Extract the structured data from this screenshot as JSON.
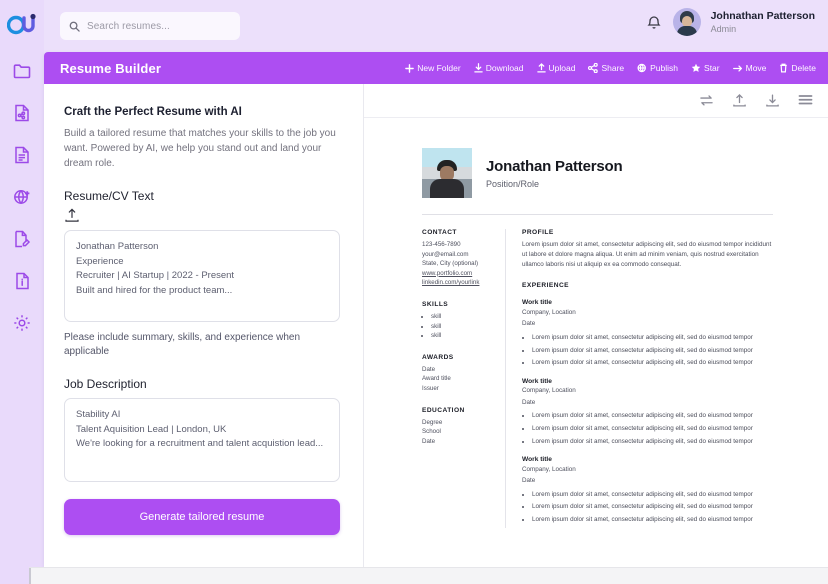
{
  "app": {
    "logo_name": "cu-logo",
    "search": {
      "placeholder": "Search resumes...",
      "value": ""
    },
    "user": {
      "name": "Johnathan Patterson",
      "role": "Admin"
    }
  },
  "sidebar": {
    "items": [
      {
        "icon": "folder-icon",
        "label": "Folders"
      },
      {
        "icon": "shared-file-icon",
        "label": "Shared"
      },
      {
        "icon": "document-icon",
        "label": "Documents"
      },
      {
        "icon": "network-add-icon",
        "label": "Network"
      },
      {
        "icon": "file-edit-icon",
        "label": "Edit"
      },
      {
        "icon": "file-info-icon",
        "label": "Info"
      },
      {
        "icon": "gear-icon",
        "label": "Settings"
      }
    ]
  },
  "window": {
    "title": "Resume Builder",
    "actions": [
      {
        "icon": "plus-icon",
        "label": "New Folder"
      },
      {
        "icon": "download-icon",
        "label": "Download"
      },
      {
        "icon": "upload-icon",
        "label": "Upload"
      },
      {
        "icon": "share-icon",
        "label": "Share"
      },
      {
        "icon": "publish-icon",
        "label": "Publish"
      },
      {
        "icon": "star-icon",
        "label": "Star"
      },
      {
        "icon": "move-icon",
        "label": "Move"
      },
      {
        "icon": "trash-icon",
        "label": "Delete"
      }
    ]
  },
  "left_pane": {
    "title": "Craft the Perfect Resume with AI",
    "subtitle": "Build a tailored resume that matches your skills to the job you want. Powered by AI, we help you stand out and land your dream role.",
    "resume_label": "Resume/CV Text",
    "resume_value": "Jonathan Patterson\nExperience\nRecruiter | AI Startup | 2022 - Present\nBuilt and hired for the product team...",
    "hint": "Please include summary, skills, and experience when applicable",
    "jd_label": "Job Description",
    "jd_value": "Stability AI\nTalent Aquisition Lead | London, UK\nWe're looking for a recruitment and talent acquistion lead...",
    "generate_button": "Generate tailored resume"
  },
  "preview": {
    "toolbar_icons": [
      "swap-icon",
      "upload-icon",
      "download-icon",
      "menu-icon"
    ],
    "name": "Jonathan Patterson",
    "role": "Position/Role",
    "contact": {
      "heading": "CONTACT",
      "phone": "123-456-7890",
      "email": "your@email.com",
      "location": "State, City (optional)",
      "portfolio": "www.portfolio.com",
      "linkedin": "linkedin.com/yourlink"
    },
    "skills": {
      "heading": "SKILLS",
      "items": [
        "skill",
        "skill",
        "skill"
      ]
    },
    "awards": {
      "heading": "AWARDS",
      "date": "Date",
      "title": "Award title",
      "issuer": "Issuer"
    },
    "education": {
      "heading": "EDUCATION",
      "degree": "Degree",
      "school": "School",
      "date": "Date"
    },
    "profile": {
      "heading": "PROFILE",
      "body": "Lorem ipsum dolor sit amet, consectetur adipiscing elit, sed do eiusmod tempor incididunt ut labore et dolore magna aliqua. Ut enim ad minim veniam, quis nostrud exercitation ullamco laboris nisi ut aliquip ex ea commodo consequat."
    },
    "experience": {
      "heading": "EXPERIENCE",
      "jobs": [
        {
          "title": "Work title",
          "company": "Company, Location",
          "date": "Date",
          "bullets": [
            "Lorem ipsum dolor sit amet, consectetur adipiscing elit, sed do eiusmod tempor",
            "Lorem ipsum dolor sit amet, consectetur adipiscing elit, sed do eiusmod tempor",
            "Lorem ipsum dolor sit amet, consectetur adipiscing elit, sed do eiusmod tempor"
          ]
        },
        {
          "title": "Work title",
          "company": "Company, Location",
          "date": "Date",
          "bullets": [
            "Lorem ipsum dolor sit amet, consectetur adipiscing elit, sed do eiusmod tempor",
            "Lorem ipsum dolor sit amet, consectetur adipiscing elit, sed do eiusmod tempor",
            "Lorem ipsum dolor sit amet, consectetur adipiscing elit, sed do eiusmod tempor"
          ]
        },
        {
          "title": "Work title",
          "company": "Company, Location",
          "date": "Date",
          "bullets": [
            "Lorem ipsum dolor sit amet, consectetur adipiscing elit, sed do eiusmod tempor",
            "Lorem ipsum dolor sit amet, consectetur adipiscing elit, sed do eiusmod tempor",
            "Lorem ipsum dolor sit amet, consectetur adipiscing elit, sed do eiusmod tempor"
          ]
        }
      ]
    }
  },
  "colors": {
    "accent": "#ad4ef2",
    "page_bg": "#ece0fb",
    "sidebar_icon": "#9c4ae8",
    "logo_blue": "#1d8fe0"
  }
}
